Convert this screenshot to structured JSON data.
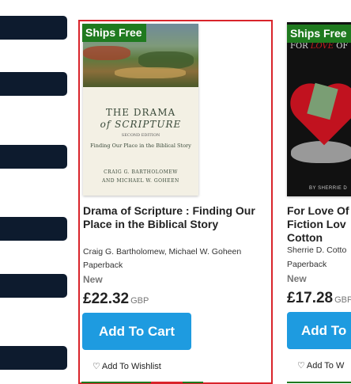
{
  "sidebar": {
    "buttons": [
      "",
      "",
      "",
      "",
      "",
      ""
    ]
  },
  "products": [
    {
      "badge": "Ships Free",
      "cover": {
        "title_line1": "THE DRAMA",
        "title_line2": "of SCRIPTURE",
        "edition": "SECOND EDITION",
        "subtitle": "Finding Our Place in the Biblical Story",
        "author_line1": "CRAIG G. BARTHOLOMEW",
        "author_line2": "AND MICHAEL W. GOHEEN"
      },
      "title": "Drama of Scripture : Finding Our Place in the Biblical Story",
      "author": "Craig G. Bartholomew, Michael W. Goheen",
      "format": "Paperback",
      "condition": "New",
      "price": "£22.32",
      "currency": "GBP",
      "cart_label": "Add To Cart",
      "wishlist_label": "Add To Wishlist"
    },
    {
      "badge": "Ships Free",
      "cover": {
        "title_prefix": "FOR ",
        "title_love": "LOVE",
        "title_suffix": " OF",
        "author": "BY SHERRIE D"
      },
      "title": "For Love Of Fiction Lov Cotton",
      "author": "Sherrie D. Cotto",
      "format": "Paperback",
      "condition": "New",
      "price": "£17.28",
      "currency": "GBP",
      "cart_label": "Add To",
      "wishlist_label": "Add To W"
    }
  ],
  "colors": {
    "badge_bg": "#1f7a1f",
    "cart_button": "#1e9be0",
    "sidebar_button": "#0d1b2e",
    "selected_border": "#d9242b"
  }
}
